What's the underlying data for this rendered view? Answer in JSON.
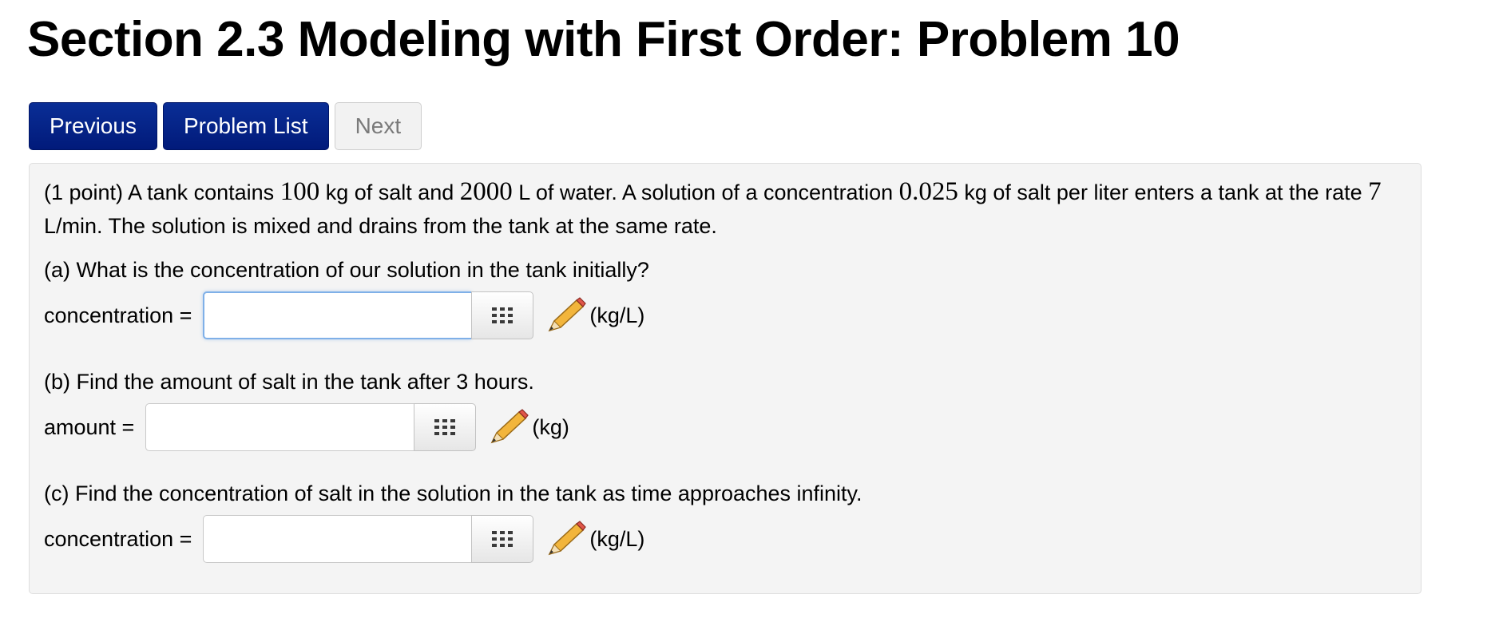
{
  "header": {
    "title": "Section 2.3 Modeling with First Order: Problem 10"
  },
  "nav": {
    "previous": "Previous",
    "problem_list": "Problem List",
    "next": "Next"
  },
  "problem": {
    "intro": {
      "p1": "(1 point) A tank contains ",
      "salt_kg": "100",
      "p2": " kg of salt and ",
      "water_L": "2000",
      "p3": " L of water. A solution of a concentration ",
      "concentration": "0.025",
      "p4": " kg of salt per liter enters a tank at the rate ",
      "rate": "7",
      "p5": " L/min. The solution is mixed and drains from the tank at the same rate."
    },
    "parts": [
      {
        "question": "(a) What is the concentration of our solution in the tank initially?",
        "label": "concentration =",
        "value": "",
        "unit": "(kg/L)"
      },
      {
        "question": "(b) Find the amount of salt in the tank after 3 hours.",
        "label": "amount =",
        "value": "",
        "unit": "(kg)"
      },
      {
        "question": "(c) Find the concentration of salt in the solution in the tank as time approaches infinity.",
        "label": "concentration =",
        "value": "",
        "unit": "(kg/L)"
      }
    ]
  },
  "icons": {
    "grid": "grid-icon",
    "pencil": "pencil-icon"
  },
  "colors": {
    "primary_button": "#011a7a",
    "problem_background": "#f4f4f4",
    "focus_border": "#7fb0e8"
  }
}
